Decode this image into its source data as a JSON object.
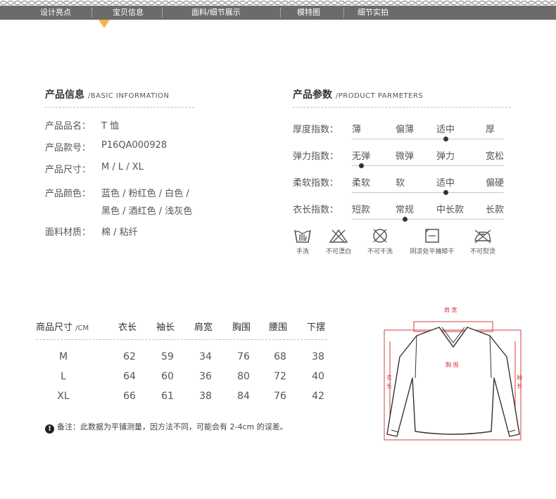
{
  "nav": {
    "items": [
      "设计亮点",
      "宝贝信息",
      "面料/细节展示",
      "模特图",
      "细节实拍"
    ],
    "active_index": 1
  },
  "basic_info": {
    "title_cn": "产品信息",
    "title_en": "BASIC INFORMATION",
    "rows": [
      {
        "label": "产品品名：",
        "value": "T 恤"
      },
      {
        "label": "产品款号：",
        "value": "P16QA000928"
      },
      {
        "label": "产品尺寸：",
        "value": "M / L / XL"
      },
      {
        "label": "产品颜色：",
        "value": "蓝色 / 粉红色 / 白色 /",
        "value2": "黑色 / 酒红色 / 浅灰色"
      },
      {
        "label": "面料材质：",
        "value": "棉 / 粘纤"
      }
    ]
  },
  "parameters": {
    "title_cn": "产品参数",
    "title_en": "PRODUCT PARMETERS",
    "rows": [
      {
        "label": "厚度指数：",
        "options": [
          "薄",
          "偏薄",
          "适中",
          "厚"
        ],
        "selected_index": 2
      },
      {
        "label": "弹力指数：",
        "options": [
          "无弹",
          "微弹",
          "弹力",
          "宽松"
        ],
        "selected_index": 0
      },
      {
        "label": "柔软指数：",
        "options": [
          "柔软",
          "软",
          "适中",
          "偏硬"
        ],
        "selected_index": 2
      },
      {
        "label": "衣长指数：",
        "options": [
          "短款",
          "常规",
          "中长款",
          "长款"
        ],
        "selected_index": 1
      }
    ]
  },
  "care": [
    {
      "label": "手洗",
      "icon": "hand-wash-icon"
    },
    {
      "label": "不可漂白",
      "icon": "no-bleach-icon"
    },
    {
      "label": "不可干洗",
      "icon": "no-dry-clean-icon"
    },
    {
      "label": "阴凉处平摊晾干",
      "icon": "dry-flat-shade-icon"
    },
    {
      "label": "不可熨烫",
      "icon": "no-iron-icon"
    }
  ],
  "size_table": {
    "header_cn": "商品尺寸",
    "header_unit": "CM",
    "columns": [
      "衣长",
      "袖长",
      "肩宽",
      "胸围",
      "腰围",
      "下摆"
    ],
    "rows": [
      {
        "size": "M",
        "values": [
          "62",
          "59",
          "34",
          "76",
          "68",
          "38"
        ]
      },
      {
        "size": "L",
        "values": [
          "64",
          "60",
          "36",
          "80",
          "72",
          "40"
        ]
      },
      {
        "size": "XL",
        "values": [
          "66",
          "61",
          "38",
          "84",
          "76",
          "42"
        ]
      }
    ]
  },
  "note": {
    "icon": "exclamation-icon",
    "text": "备注：此数据为平铺测量，因方法不同，可能会有 2-4cm 的误差。"
  },
  "diagram": {
    "shoulder": "肩 宽",
    "chest": "胸 围",
    "length_1": "衣",
    "length_2": "长",
    "sleeve_1": "袖",
    "sleeve_2": "长"
  },
  "colors": {
    "nav_bg": "#6b6b6b",
    "nav_marker": "#f2b544",
    "measure_line": "#d04040"
  }
}
